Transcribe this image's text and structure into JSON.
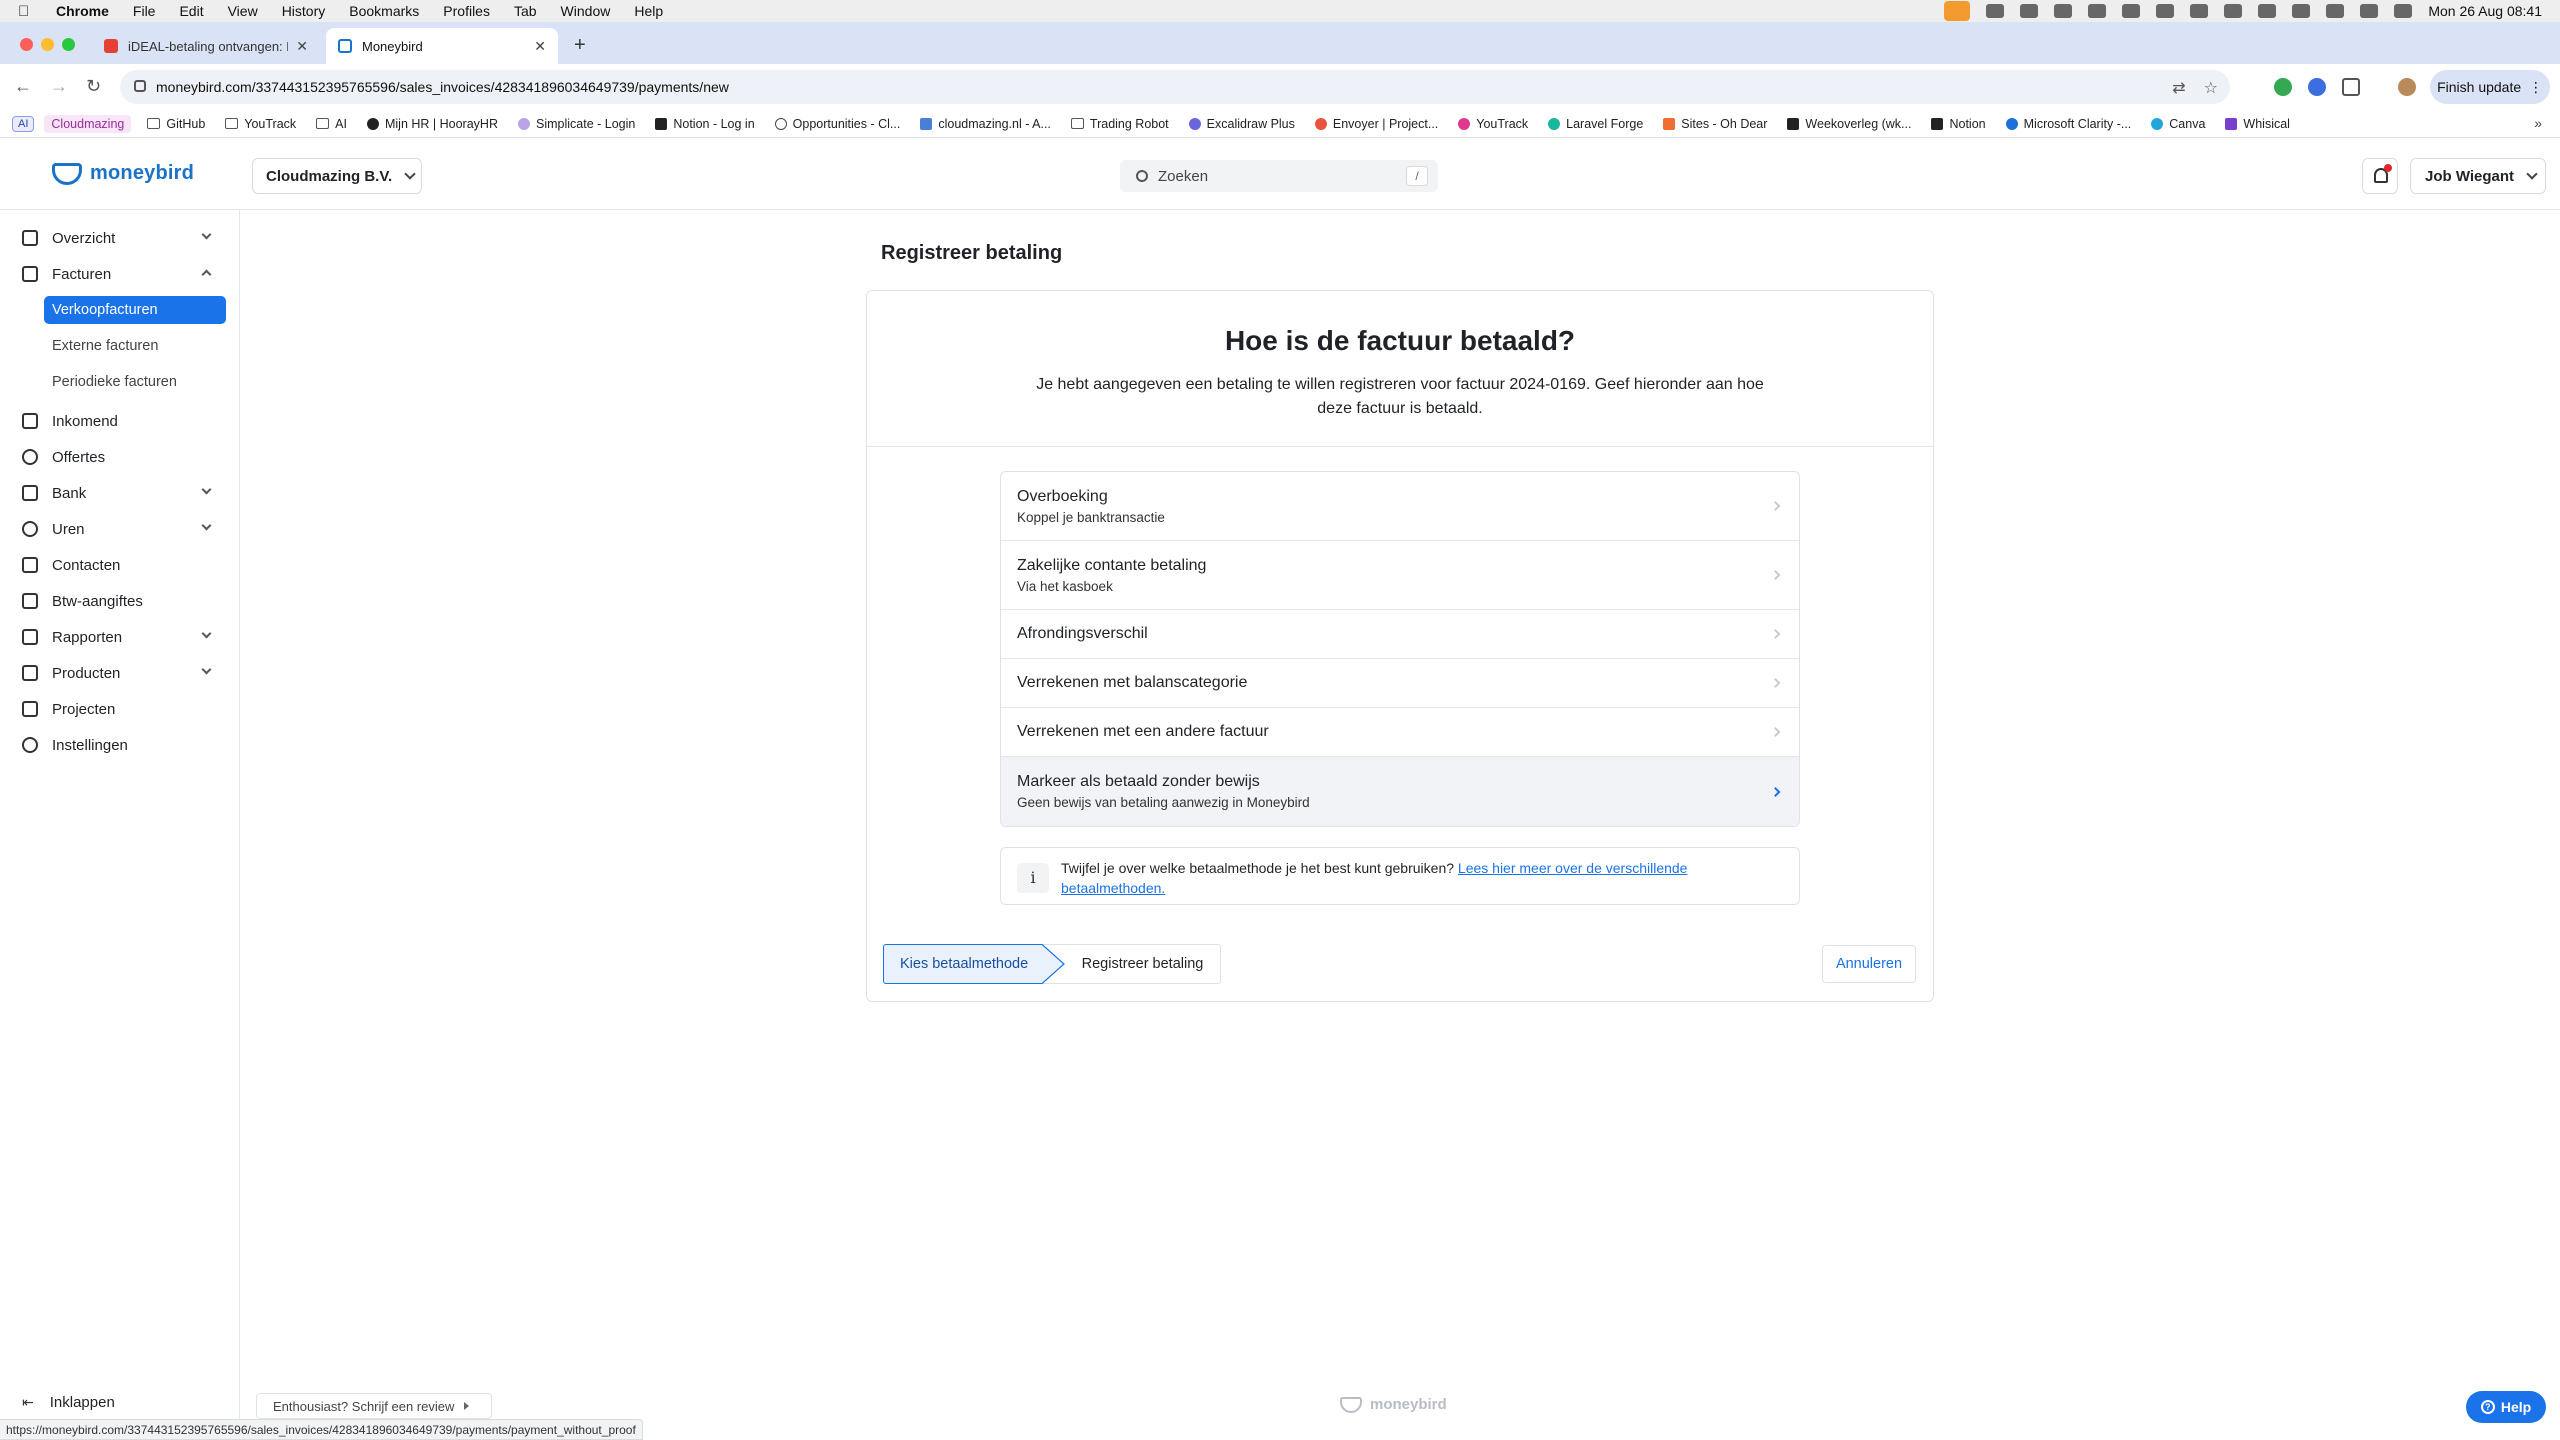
{
  "menubar": {
    "app": "Chrome",
    "items": [
      "File",
      "Edit",
      "View",
      "History",
      "Bookmarks",
      "Profiles",
      "Tab",
      "Window",
      "Help"
    ],
    "clock": "Mon 26 Aug  08:41"
  },
  "browser": {
    "tabs": [
      {
        "title": "iDEAL-betaling ontvangen: Fa"
      },
      {
        "title": "Moneybird"
      }
    ],
    "url": "moneybird.com/337443152395765596/sales_invoices/428341896034649739/payments/new",
    "finish_update": "Finish update",
    "status_url": "https://moneybird.com/337443152395765596/sales_invoices/428341896034649739/payments/payment_without_proof"
  },
  "bookmarks": {
    "ai_badge": "AI",
    "profile": "Cloudmazing",
    "items": [
      "GitHub",
      "YouTrack",
      "AI",
      "Mijn HR | HoorayHR",
      "Simplicate - Login",
      "Notion - Log in",
      "Opportunities - Cl...",
      "cloudmazing.nl - A...",
      "Trading Robot",
      "Excalidraw Plus",
      "Envoyer | Project...",
      "YouTrack",
      "Laravel Forge",
      "Sites - Oh Dear",
      "Weekoverleg (wk...",
      "Notion",
      "Microsoft Clarity -...",
      "Canva",
      "Whisical"
    ]
  },
  "header": {
    "logo": "moneybird",
    "company": "Cloudmazing B.V.",
    "search_placeholder": "Zoeken",
    "search_shortcut": "/",
    "user": "Job Wiegant"
  },
  "sidebar": {
    "items": [
      {
        "label": "Overzicht"
      },
      {
        "label": "Facturen"
      },
      {
        "label": "Inkomend"
      },
      {
        "label": "Offertes"
      },
      {
        "label": "Bank"
      },
      {
        "label": "Uren"
      },
      {
        "label": "Contacten"
      },
      {
        "label": "Btw-aangiftes"
      },
      {
        "label": "Rapporten"
      },
      {
        "label": "Producten"
      },
      {
        "label": "Projecten"
      },
      {
        "label": "Instellingen"
      }
    ],
    "sub_items": [
      {
        "label": "Verkoopfacturen"
      },
      {
        "label": "Externe facturen"
      },
      {
        "label": "Periodieke facturen"
      }
    ],
    "collapse": "Inklappen"
  },
  "main": {
    "page_title": "Registreer betaling",
    "heading": "Hoe is de factuur betaald?",
    "intro": "Je hebt aangegeven een betaling te willen registreren voor factuur 2024-0169. Geef hieronder aan hoe deze factuur is betaald.",
    "options": [
      {
        "title": "Overboeking",
        "subtitle": "Koppel je banktransactie"
      },
      {
        "title": "Zakelijke contante betaling",
        "subtitle": "Via het kasboek"
      },
      {
        "title": "Afrondingsverschil"
      },
      {
        "title": "Verrekenen met balanscategorie"
      },
      {
        "title": "Verrekenen met een andere factuur"
      },
      {
        "title": "Markeer als betaald zonder bewijs",
        "subtitle": "Geen bewijs van betaling aanwezig in Moneybird"
      }
    ],
    "info_text": "Twijfel je over welke betaalmethode je het best kunt gebruiken?",
    "info_link": "Lees hier meer over de verschillende betaalmethoden.",
    "steps": [
      "Kies betaalmethode",
      "Registreer betaling"
    ],
    "cancel": "Annuleren"
  },
  "footer": {
    "review": "Enthousiast? Schrijf een review",
    "logo": "moneybird",
    "help": "Help"
  },
  "colors": {
    "accent": "#1a73e8",
    "brand": "#1a73c8",
    "tabstrip": "#d9e3f5"
  }
}
